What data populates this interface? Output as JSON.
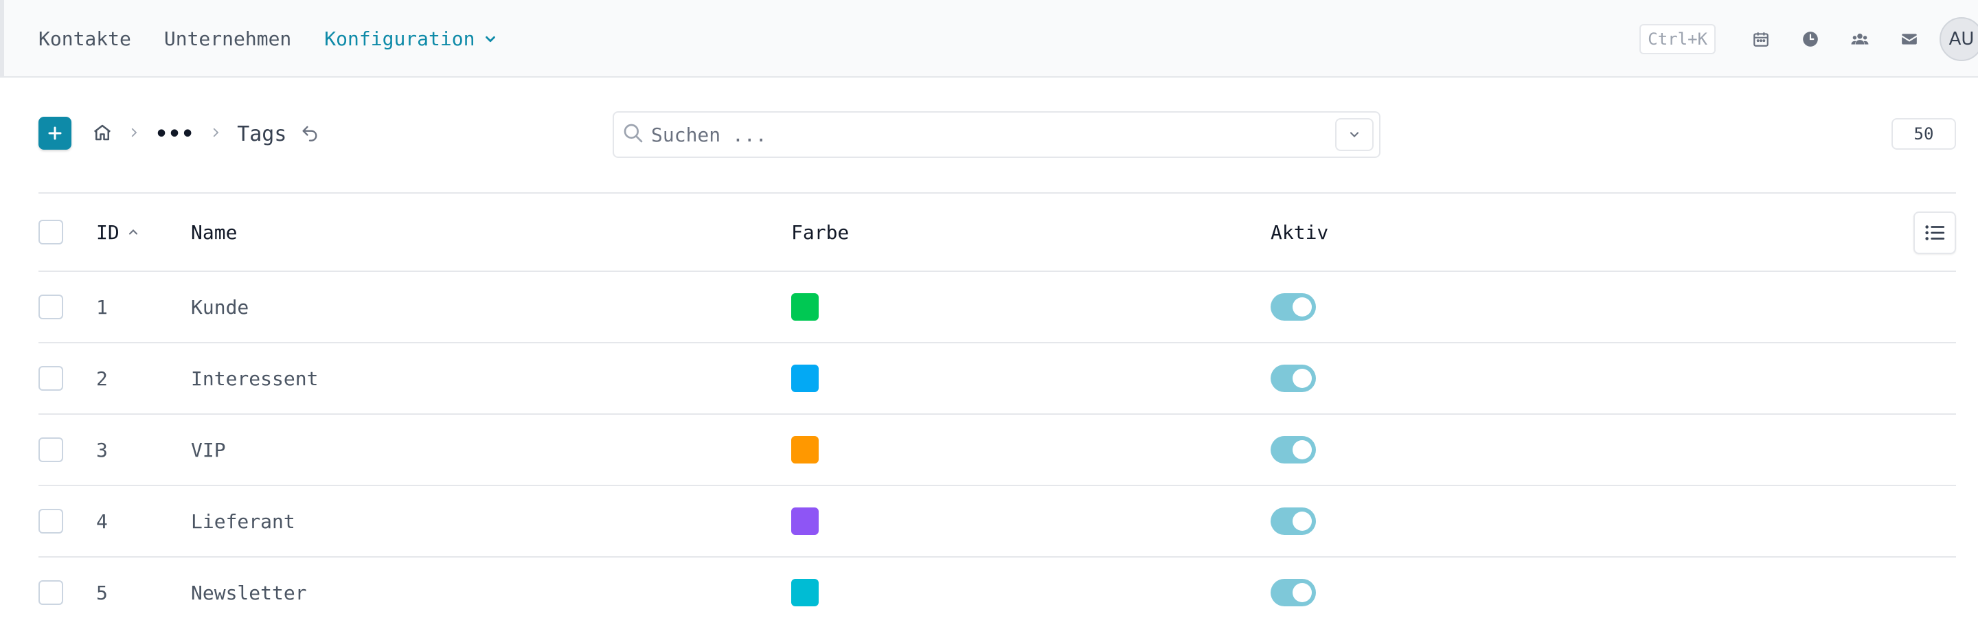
{
  "nav": {
    "items": [
      "Kontakte",
      "Unternehmen"
    ],
    "active": "Konfiguration"
  },
  "top_right": {
    "shortcut": "Ctrl+K",
    "icons": [
      "calendar-icon",
      "clock-icon",
      "users-icon",
      "mail-icon"
    ],
    "avatar_initials": "AU"
  },
  "toolbar": {
    "breadcrumb_more": "•••",
    "breadcrumb_title": "Tags",
    "search_placeholder": "Suchen ...",
    "page_size": "50"
  },
  "colors": {
    "accent": "#0e8aa8",
    "toggle_on": "#7ec8d9"
  },
  "table": {
    "headers": {
      "id": "ID",
      "name": "Name",
      "color": "Farbe",
      "active": "Aktiv"
    },
    "sort": {
      "column": "ID",
      "direction": "ascending"
    },
    "rows": [
      {
        "id": "1",
        "name": "Kunde",
        "color": "#00c853",
        "active": true
      },
      {
        "id": "2",
        "name": "Interessent",
        "color": "#03a9f4",
        "active": true
      },
      {
        "id": "3",
        "name": "VIP",
        "color": "#ff9800",
        "active": true
      },
      {
        "id": "4",
        "name": "Lieferant",
        "color": "#8e55f5",
        "active": true
      },
      {
        "id": "5",
        "name": "Newsletter",
        "color": "#00bcd4",
        "active": true
      }
    ]
  }
}
